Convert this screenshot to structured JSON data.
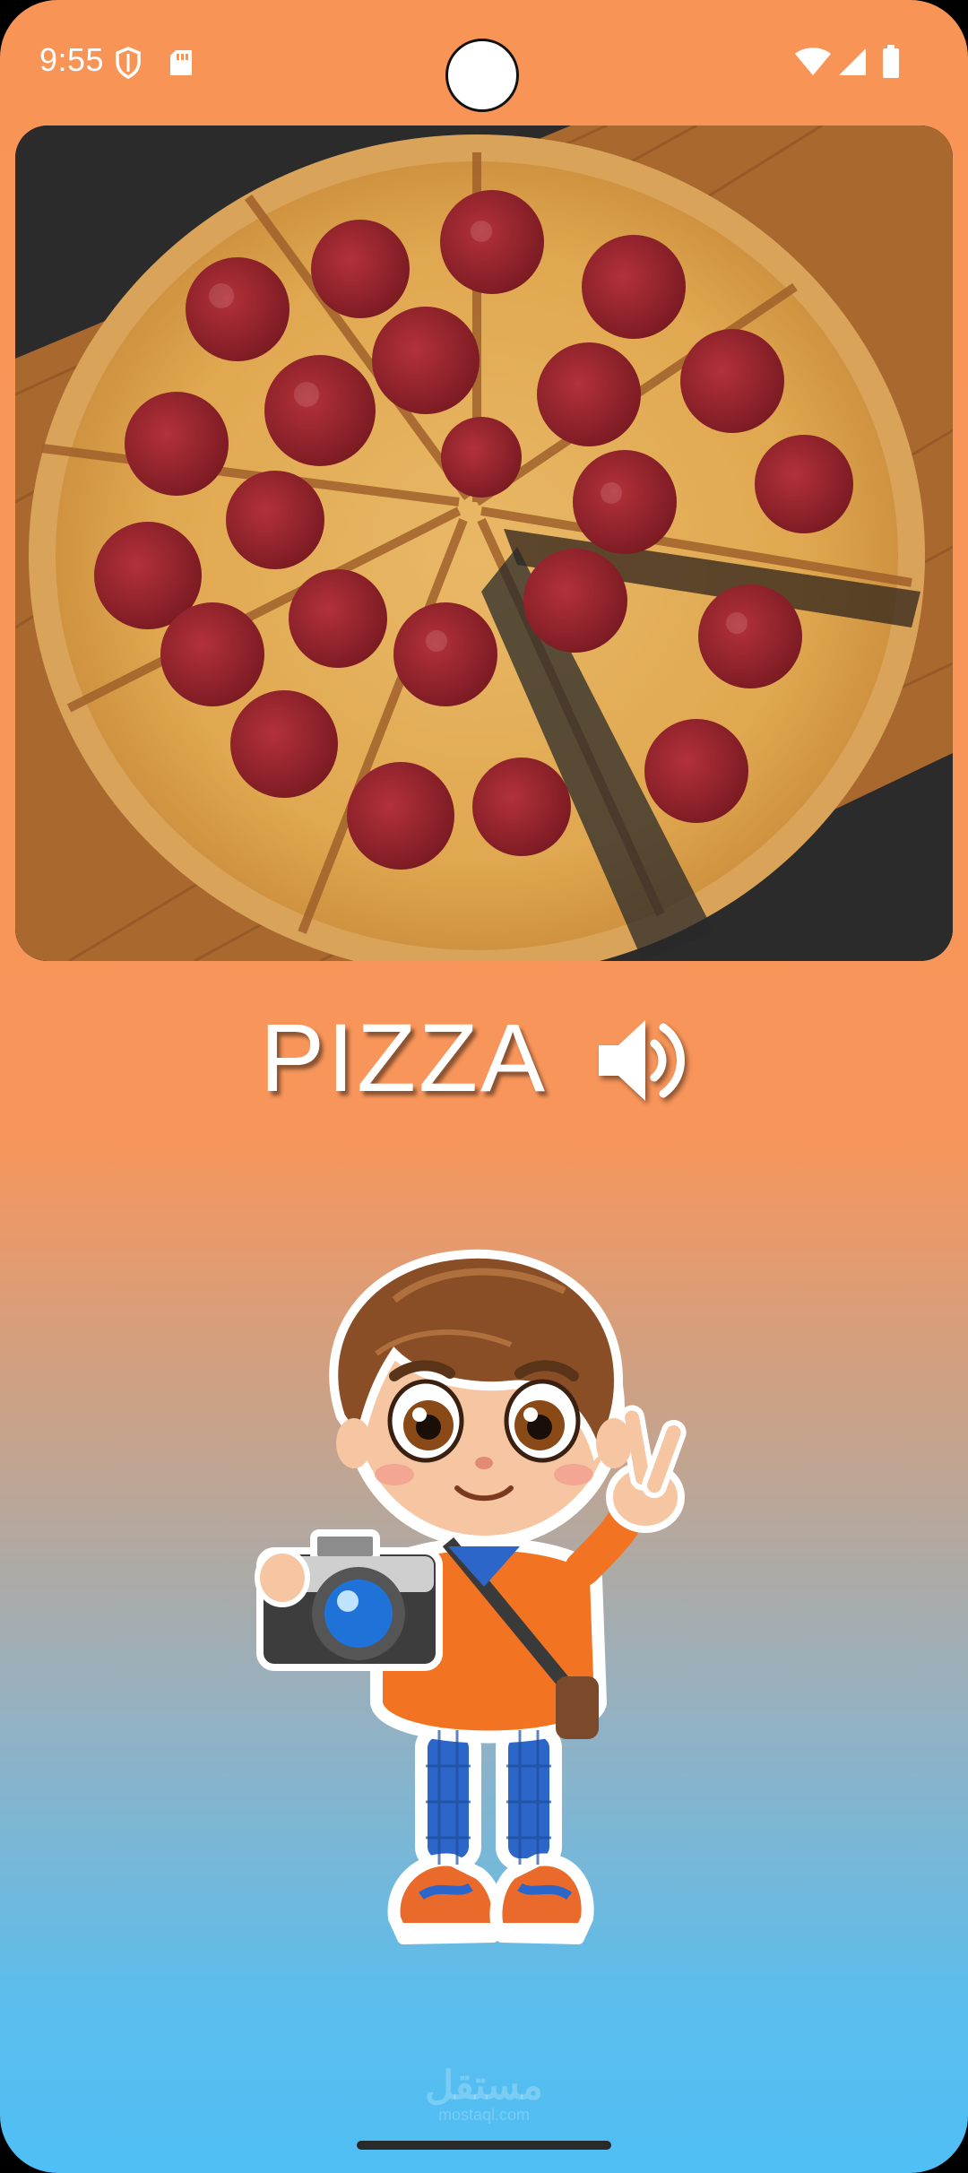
{
  "status_bar": {
    "time": "9:55",
    "icons": [
      "shield-icon",
      "sd-card-icon",
      "wifi-icon",
      "cell-signal-icon",
      "battery-icon"
    ]
  },
  "card": {
    "image": "pepperoni-pizza-photo"
  },
  "word": {
    "text": "PIZZA",
    "speaker_icon": "speaker-volume-icon"
  },
  "illustration": "boy-with-camera-peace-sign",
  "watermark": {
    "arabic": "مستقل",
    "latin": "mostaql.com"
  },
  "colors": {
    "background_top": "#F89556",
    "background_bottom": "#4FBFF5",
    "word_color": "#FFFFFF"
  }
}
